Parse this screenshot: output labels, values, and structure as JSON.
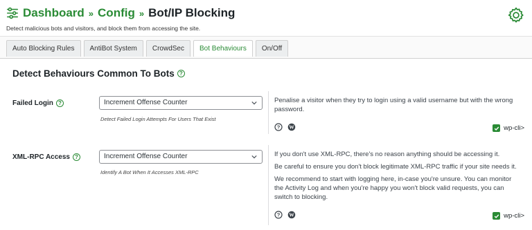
{
  "breadcrumb": {
    "items": [
      "Dashboard",
      "Config"
    ],
    "separator": "»",
    "current": "Bot/IP Blocking"
  },
  "subtitle": "Detect malicious bots and visitors, and block them from accessing the site.",
  "tabs": [
    {
      "label": "Auto Blocking Rules",
      "active": false
    },
    {
      "label": "AntiBot System",
      "active": false
    },
    {
      "label": "CrowdSec",
      "active": false
    },
    {
      "label": "Bot Behaviours",
      "active": true
    },
    {
      "label": "On/Off",
      "active": false
    }
  ],
  "section": {
    "title": "Detect Behaviours Common To Bots",
    "help": "?"
  },
  "options": [
    {
      "label": "Failed Login",
      "help": "?",
      "select_value": "Increment Offense Counter",
      "hint": "Detect Failed Login Attempts For Users That Exist",
      "description": [
        "Penalise a visitor when they try to login using a valid username but with the wrong password."
      ],
      "wpcli": "wp-cli>"
    },
    {
      "label": "XML-RPC Access",
      "help": "?",
      "select_value": "Increment Offense Counter",
      "hint": "Identify A Bot When It Accesses XML-RPC",
      "description": [
        "If you don't use XML-RPC, there's no reason anything should be accessing it.",
        "Be careful to ensure you don't block legitimate XML-RPC traffic if your site needs it.",
        "We recommend to start with logging here, in-case you're unsure. You can monitor the Activity Log and when you're happy you won't block valid requests, you can switch to blocking."
      ],
      "wpcli": "wp-cli>"
    }
  ],
  "colors": {
    "accent": "#2a8b35",
    "text": "#1d2327"
  }
}
